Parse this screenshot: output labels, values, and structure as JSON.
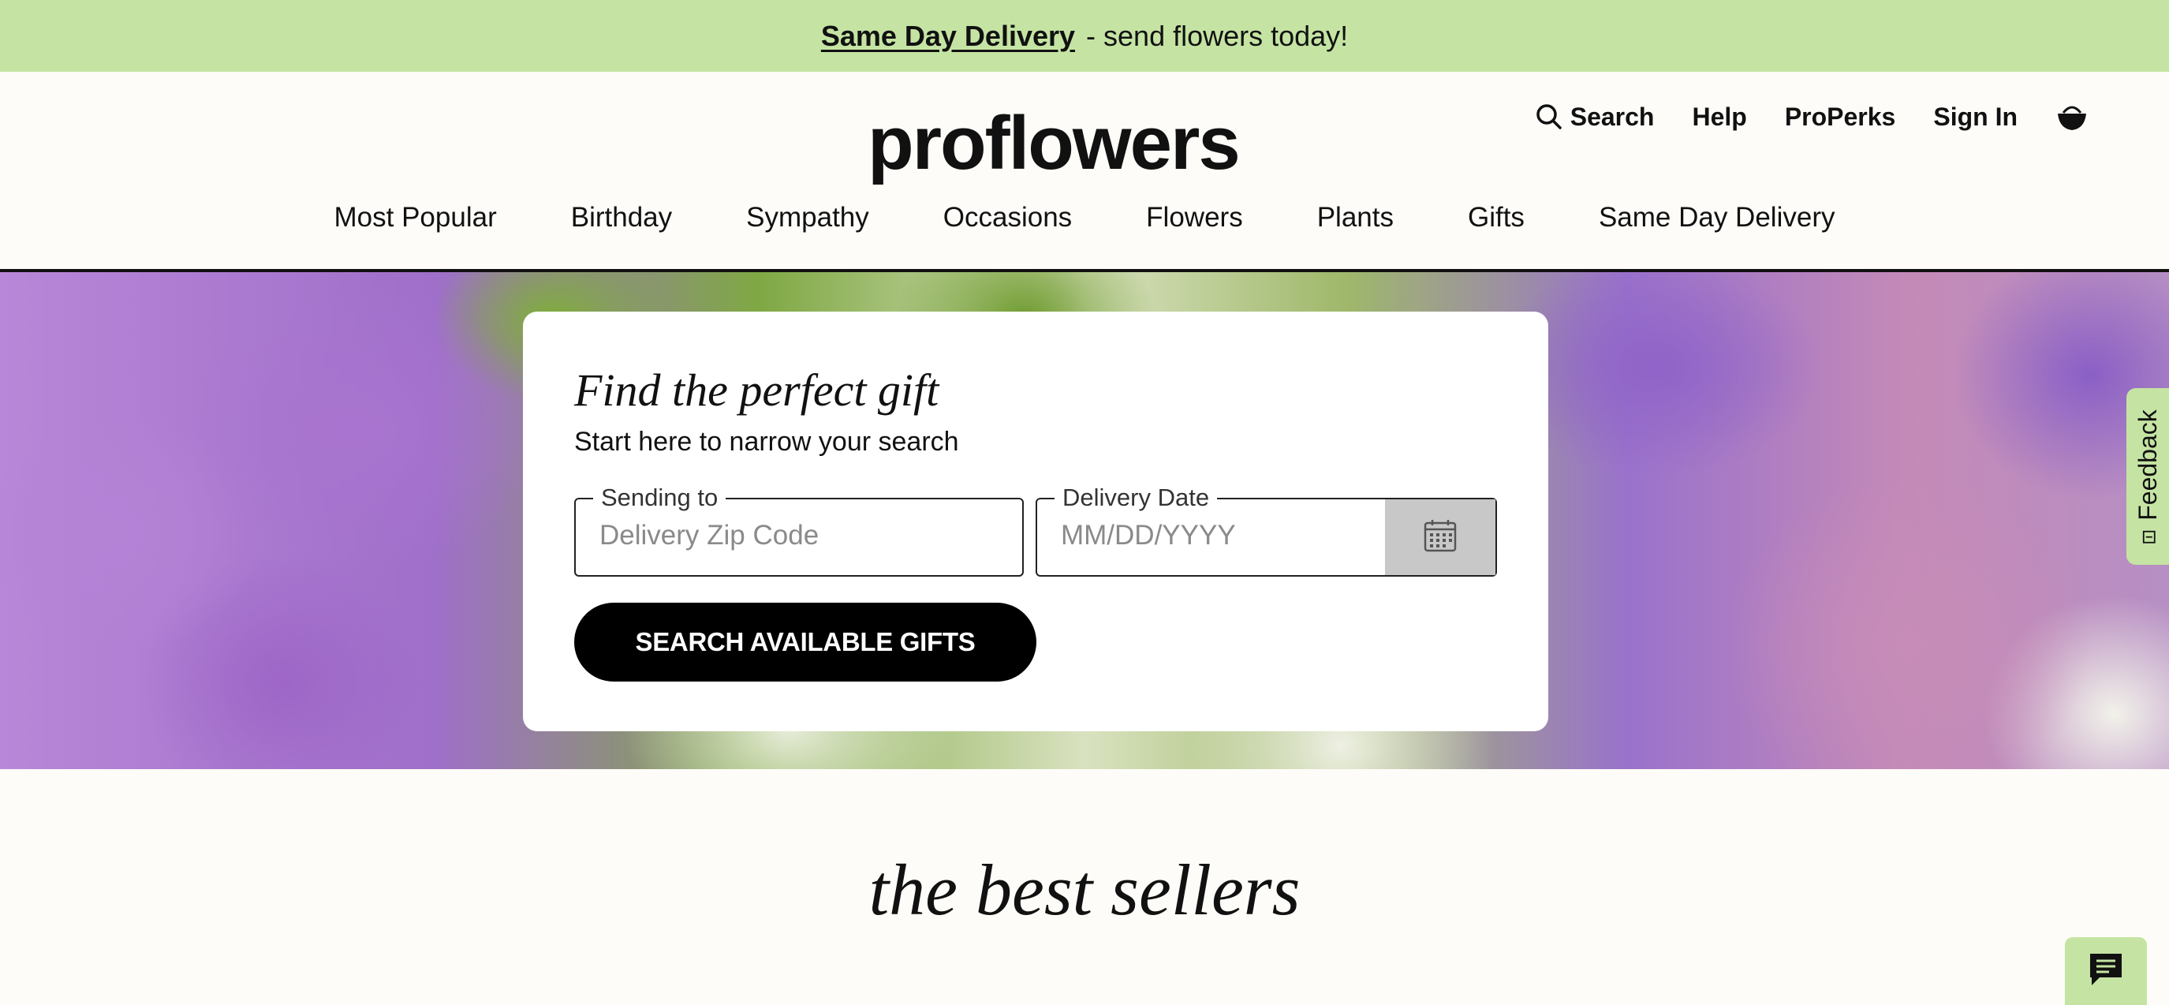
{
  "promo": {
    "link_text": "Same Day Delivery",
    "rest_text": "- send flowers today!"
  },
  "header": {
    "logo": "proflowers",
    "utility": {
      "search": "Search",
      "help": "Help",
      "properks": "ProPerks",
      "signin": "Sign In"
    },
    "nav": [
      "Most Popular",
      "Birthday",
      "Sympathy",
      "Occasions",
      "Flowers",
      "Plants",
      "Gifts",
      "Same Day Delivery"
    ]
  },
  "finder": {
    "title": "Find the perfect gift",
    "subtitle": "Start here to narrow your search",
    "zip_label": "Sending to",
    "zip_placeholder": "Delivery Zip Code",
    "zip_value": "",
    "date_label": "Delivery Date",
    "date_placeholder": "MM/DD/YYYY",
    "date_value": "",
    "button": "SEARCH AVAILABLE GIFTS"
  },
  "feedback": {
    "label": "Feedback"
  },
  "section": {
    "title": "the best sellers"
  },
  "colors": {
    "promo_bg": "#c5e4a3",
    "page_bg": "#fdfcf8",
    "button_bg": "#000000",
    "calendar_btn_bg": "#c8c8c8"
  },
  "icons": {
    "search": "search-icon",
    "cart": "basket-icon",
    "calendar": "calendar-icon",
    "chat": "chat-icon",
    "feedback": "feedback-icon"
  }
}
